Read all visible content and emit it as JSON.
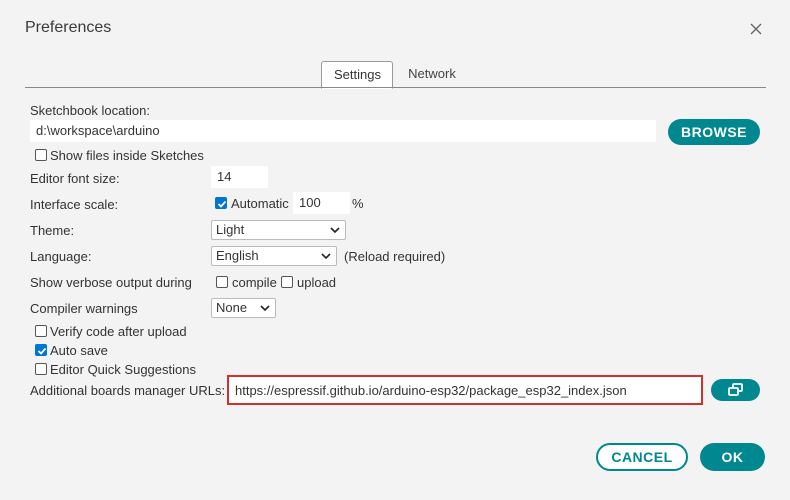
{
  "window": {
    "title": "Preferences"
  },
  "tabs": [
    {
      "label": "Settings",
      "active": true
    },
    {
      "label": "Network",
      "active": false
    }
  ],
  "sketchbook": {
    "label": "Sketchbook location:",
    "value": "d:\\workspace\\arduino",
    "browse_label": "BROWSE",
    "show_files_label": "Show files inside Sketches",
    "show_files_checked": false
  },
  "editor_font": {
    "label": "Editor font size:",
    "value": "14"
  },
  "interface_scale": {
    "label": "Interface scale:",
    "automatic_label": "Automatic",
    "automatic_checked": true,
    "value": "100",
    "unit": "%"
  },
  "theme": {
    "label": "Theme:",
    "selected": "Light"
  },
  "language": {
    "label": "Language:",
    "selected": "English",
    "note": "(Reload required)"
  },
  "verbose": {
    "label": "Show verbose output during",
    "compile_label": "compile",
    "compile_checked": false,
    "upload_label": "upload",
    "upload_checked": false
  },
  "compiler_warnings": {
    "label": "Compiler warnings",
    "selected": "None"
  },
  "options": [
    {
      "label": "Verify code after upload",
      "checked": false
    },
    {
      "label": "Auto save",
      "checked": true
    },
    {
      "label": "Editor Quick Suggestions",
      "checked": false
    }
  ],
  "boards_urls": {
    "label": "Additional boards manager URLs:",
    "value": "https://espressif.github.io/arduino-esp32/package_esp32_index.json"
  },
  "footer": {
    "cancel_label": "CANCEL",
    "ok_label": "OK"
  },
  "colors": {
    "accent": "#00878f",
    "checkbox": "#0075d1",
    "highlight": "#d32f2f"
  },
  "icons": {
    "close": "close-icon",
    "expand": "open-window-icon",
    "chevron": "chevron-down-icon"
  }
}
